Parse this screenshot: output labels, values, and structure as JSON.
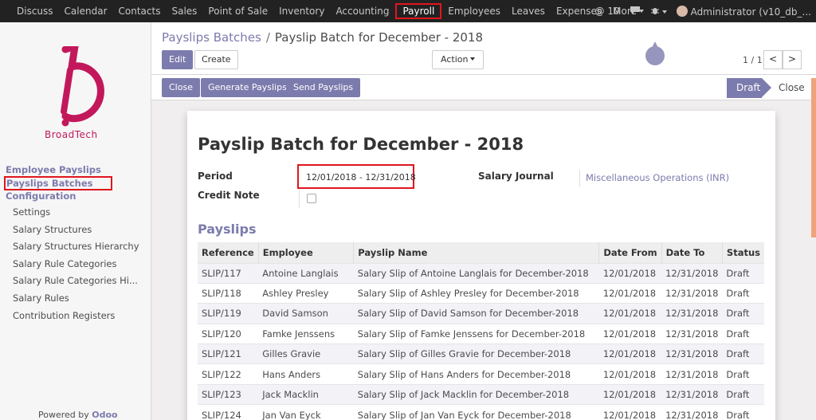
{
  "topnav": {
    "items": [
      "Discuss",
      "Calendar",
      "Contacts",
      "Sales",
      "Point of Sale",
      "Inventory",
      "Accounting",
      "Payroll",
      "Employees",
      "Leaves",
      "Expenses",
      "More"
    ],
    "active": "Payroll",
    "chat_count": "@ 10",
    "user": "Administrator (v10_db_..."
  },
  "sidebar": {
    "brand": "BroadTech",
    "groups": [
      "Employee Payslips",
      "Payslips Batches",
      "Configuration"
    ],
    "config_items": [
      "Settings",
      "Salary Structures",
      "Salary Structures Hierarchy",
      "Salary Rule Categories",
      "Salary Rule Categories Hi...",
      "Salary Rules",
      "Contribution Registers"
    ],
    "powered_by": "Powered by",
    "powered_brand": "Odoo"
  },
  "control": {
    "breadcrumb_parent": "Payslips Batches",
    "breadcrumb_sep": "/",
    "breadcrumb_current": "Payslip Batch for December - 2018",
    "edit_label": "Edit",
    "create_label": "Create",
    "action_label": "Action",
    "pager": "1 / 1",
    "prev": "<",
    "next": ">"
  },
  "statusbar": {
    "buttons": [
      "Close",
      "Generate Payslips",
      "Send Payslips"
    ],
    "stage_active": "Draft",
    "stage_next": "Close"
  },
  "form": {
    "title": "Payslip Batch for December - 2018",
    "period_label": "Period",
    "period_value": "12/01/2018 - 12/31/2018",
    "journal_label": "Salary Journal",
    "journal_value": "Miscellaneous Operations (INR)",
    "credit_note_label": "Credit Note",
    "credit_note_checked": false,
    "payslips_header": "Payslips"
  },
  "table": {
    "columns": [
      "Reference",
      "Employee",
      "Payslip Name",
      "Date From",
      "Date To",
      "Status"
    ],
    "rows": [
      [
        "SLIP/117",
        "Antoine Langlais",
        "Salary Slip of Antoine Langlais for December-2018",
        "12/01/2018",
        "12/31/2018",
        "Draft"
      ],
      [
        "SLIP/118",
        "Ashley Presley",
        "Salary Slip of Ashley Presley for December-2018",
        "12/01/2018",
        "12/31/2018",
        "Draft"
      ],
      [
        "SLIP/119",
        "David Samson",
        "Salary Slip of David Samson for December-2018",
        "12/01/2018",
        "12/31/2018",
        "Draft"
      ],
      [
        "SLIP/120",
        "Famke Jenssens",
        "Salary Slip of Famke Jenssens for December-2018",
        "12/01/2018",
        "12/31/2018",
        "Draft"
      ],
      [
        "SLIP/121",
        "Gilles Gravie",
        "Salary Slip of Gilles Gravie for December-2018",
        "12/01/2018",
        "12/31/2018",
        "Draft"
      ],
      [
        "SLIP/122",
        "Hans Anders",
        "Salary Slip of Hans Anders for December-2018",
        "12/01/2018",
        "12/31/2018",
        "Draft"
      ],
      [
        "SLIP/123",
        "Jack Macklin",
        "Salary Slip of Jack Macklin for December-2018",
        "12/01/2018",
        "12/31/2018",
        "Draft"
      ],
      [
        "SLIP/124",
        "Jan Van Eyck",
        "Salary Slip of Jan Van Eyck for December-2018",
        "12/01/2018",
        "12/31/2018",
        "Draft"
      ]
    ]
  },
  "colors": {
    "accent": "#7c7bad",
    "highlight": "#e0161d",
    "topbar": "#222222"
  }
}
